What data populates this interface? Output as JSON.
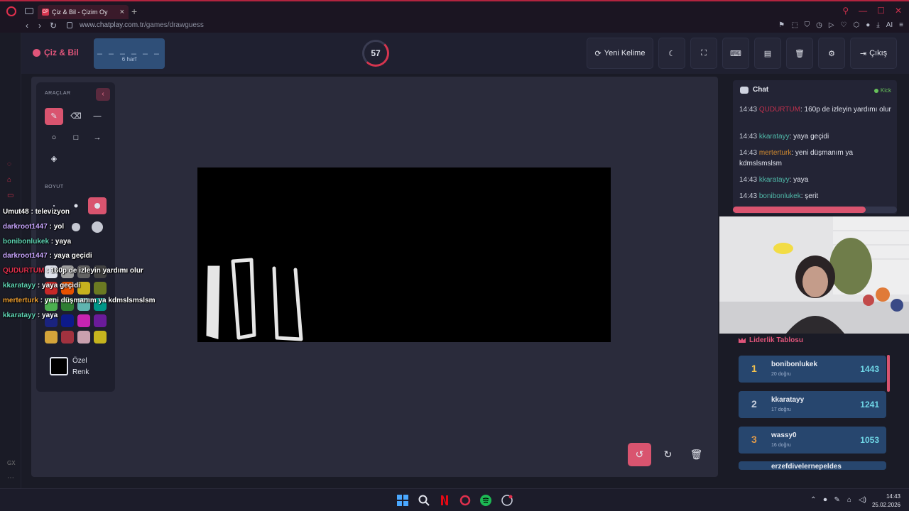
{
  "browser": {
    "tab_title": "Çiz & Bil - Çizim Oy",
    "tab_favicon": "CP",
    "url_host": "www.chatplay.com.tr",
    "url_path": "/games/drawguess",
    "ai_label": "AI"
  },
  "header": {
    "brand": "Çiz & Bil",
    "word_dashes": "_ _ _ _ _ _",
    "word_hint": "6 harf",
    "timer": "57",
    "new_word": "Yeni Kelime",
    "exit": "Çıkış"
  },
  "tools": {
    "section_tools": "ARAÇLAR",
    "section_size": "BOYUT",
    "custom_color": "Özel",
    "custom_color2": "Renk",
    "palette": [
      "#4caf50",
      "#2e7d32",
      "#5fb4b0",
      "#009688",
      "#1a237e",
      "#0d1a8a",
      "#c724b1",
      "#6a1b9a",
      "#d4a43a",
      "#a1323f",
      "#c9a0ae",
      "#c6b41e"
    ],
    "row_colors": [
      "#dfe2ec",
      "#9e9e9e",
      "#616161",
      "#424242",
      "#c62828",
      "#e65100",
      "#c7b21e",
      "#6b7a22"
    ]
  },
  "overlay_chat": [
    {
      "user": "Umut48",
      "text": ": televizyon",
      "color": "#ffffff"
    },
    {
      "user": "darkroot1447",
      "text": ": yol",
      "color": "#c9a6ff"
    },
    {
      "user": "bonibonlukek",
      "text": ": yaya",
      "color": "#5fd4b4"
    },
    {
      "user": "darkroot1447",
      "text": ": yaya geçidi",
      "color": "#c9a6ff"
    },
    {
      "user": "QUDURTUM",
      "text": ": 160p de izleyin yardımı olur",
      "color": "#e0304d"
    },
    {
      "user": "kkaratayy",
      "text": ": yaya geçidi",
      "color": "#5fd4b4"
    },
    {
      "user": "merterturk",
      "text": ": yeni düşmanım ya kdmslsmslsm",
      "color": "#f0a030"
    },
    {
      "user": "kkaratayy",
      "text": ": yaya",
      "color": "#5fd4b4"
    }
  ],
  "chat": {
    "title": "Chat",
    "platform": "Kick",
    "messages": [
      {
        "time": "14:43",
        "user": "QUDURTUM",
        "text": ": 160p de izleyin yardımı olur",
        "color": "#c0304d"
      },
      {
        "time": "14:43",
        "user": "kkaratayy",
        "text": ": yaya geçidi",
        "color": "#4fb8a8"
      },
      {
        "time": "14:43",
        "user": "merterturk",
        "text": ": yeni düşmanım ya kdmslsmslsm",
        "color": "#d08a30"
      },
      {
        "time": "14:43",
        "user": "kkaratayy",
        "text": ": yaya",
        "color": "#4fb8a8"
      },
      {
        "time": "14:43",
        "user": "bonibonlukek",
        "text": ": şerit",
        "color": "#4fb8a8"
      }
    ]
  },
  "leaderboard": {
    "title": "Liderlik Tablosu",
    "rows": [
      {
        "rank": "1",
        "name": "bonibonlukek",
        "sub": "20 doğru",
        "score": "1443"
      },
      {
        "rank": "2",
        "name": "kkaratayy",
        "sub": "17 doğru",
        "score": "1241"
      },
      {
        "rank": "3",
        "name": "wassy0",
        "sub": "16 doğru",
        "score": "1053"
      }
    ],
    "partial_name": "erzefdivelernepeldes"
  },
  "taskbar": {
    "time": "14:43",
    "date": "25.02.2026"
  }
}
